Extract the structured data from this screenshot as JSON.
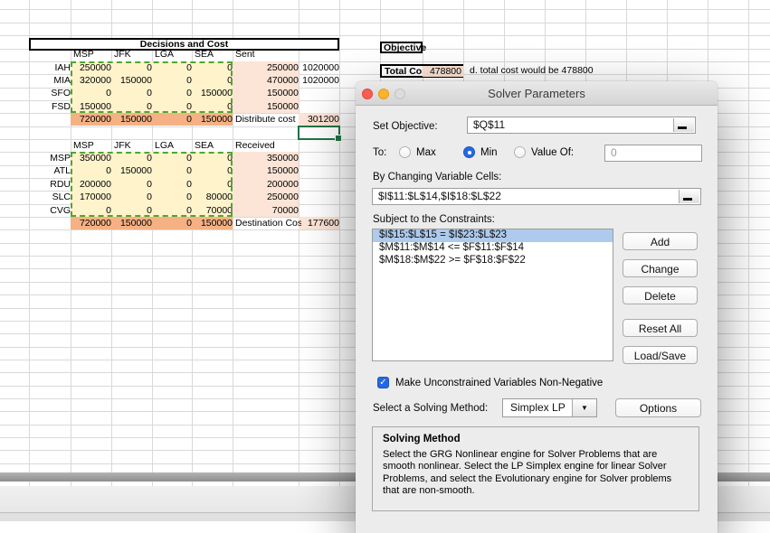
{
  "sheet": {
    "title_box": "Decisions and Cost",
    "objective_header": "Objective",
    "total_cost_label": "Total Cost",
    "total_cost_value": "478800",
    "annotation": "d. total cost would be 478800",
    "colors": {
      "cell_fill_yellow": "#FFF3CC",
      "cell_fill_pink": "#FCE4D6",
      "cell_fill_orange": "#F5B183",
      "marquee_green": "#4EA72E",
      "selection_green": "#217346"
    },
    "table1": {
      "col_headers": [
        "MSP",
        "JFK",
        "LGA",
        "SEA"
      ],
      "flow_header": "Sent",
      "rows": [
        {
          "label": "IAH",
          "values": [
            "250000",
            "0",
            "0",
            "0"
          ],
          "flow": "250000",
          "extra": "1020000"
        },
        {
          "label": "MIA",
          "values": [
            "320000",
            "150000",
            "0",
            "0"
          ],
          "flow": "470000",
          "extra": "1020000"
        },
        {
          "label": "SFO",
          "values": [
            "0",
            "0",
            "0",
            "150000"
          ],
          "flow": "150000",
          "extra": ""
        },
        {
          "label": "FSD",
          "values": [
            "150000",
            "0",
            "0",
            "0"
          ],
          "flow": "150000",
          "extra": ""
        }
      ],
      "totals": [
        "720000",
        "150000",
        "0",
        "150000"
      ],
      "total_label": "Distribute cost",
      "total_value": "301200"
    },
    "table2": {
      "col_headers": [
        "MSP",
        "JFK",
        "LGA",
        "SEA"
      ],
      "flow_header": "Received",
      "rows": [
        {
          "label": "MSP",
          "values": [
            "350000",
            "0",
            "0",
            "0"
          ],
          "flow": "350000",
          "extra": ""
        },
        {
          "label": "ATL",
          "values": [
            "0",
            "150000",
            "0",
            "0"
          ],
          "flow": "150000",
          "extra": ""
        },
        {
          "label": "RDU",
          "values": [
            "200000",
            "0",
            "0",
            "0"
          ],
          "flow": "200000",
          "extra": ""
        },
        {
          "label": "SLC",
          "values": [
            "170000",
            "0",
            "0",
            "80000"
          ],
          "flow": "250000",
          "extra": ""
        },
        {
          "label": "CVG",
          "values": [
            "0",
            "0",
            "0",
            "70000"
          ],
          "flow": "70000",
          "extra": ""
        }
      ],
      "totals": [
        "720000",
        "150000",
        "0",
        "150000"
      ],
      "total_label": "Destination Cost",
      "total_value": "177600"
    }
  },
  "dialog": {
    "title": "Solver Parameters",
    "set_objective_label": "Set Objective:",
    "objective_value": "$Q$11",
    "to_label": "To:",
    "radio_max": "Max",
    "radio_min": "Min",
    "radio_value_of": "Value Of:",
    "value_of_value": "0",
    "by_changing_label": "By Changing Variable Cells:",
    "variable_cells_value": "$I$11:$L$14,$I$18:$L$22",
    "constraints_label": "Subject to the Constraints:",
    "constraints": [
      "$I$15:$L$15 = $I$23:$L$23",
      "$M$11:$M$14 <= $F$11:$F$14",
      "$M$18:$M$22 >= $F$18:$F$22"
    ],
    "selected_constraint_index": 0,
    "buttons": {
      "add": "Add",
      "change": "Change",
      "delete": "Delete",
      "reset_all": "Reset All",
      "load_save": "Load/Save",
      "options": "Options"
    },
    "non_negative_label": "Make Unconstrained Variables Non-Negative",
    "non_negative_checked": true,
    "check_glyph": "✓",
    "solving_method_label": "Select a Solving Method:",
    "solving_method_value": "Simplex LP",
    "dropdown_arrow": "▼",
    "solving_method_box_title": "Solving Method",
    "solving_method_description": "Select the GRG Nonlinear engine for Solver Problems that are smooth nonlinear. Select the LP Simplex engine for linear Solver Problems, and select the Evolutionary engine for Solver problems that are non-smooth.",
    "accent_blue": "#2568E4",
    "constraint_highlight": "#AECBEE"
  }
}
